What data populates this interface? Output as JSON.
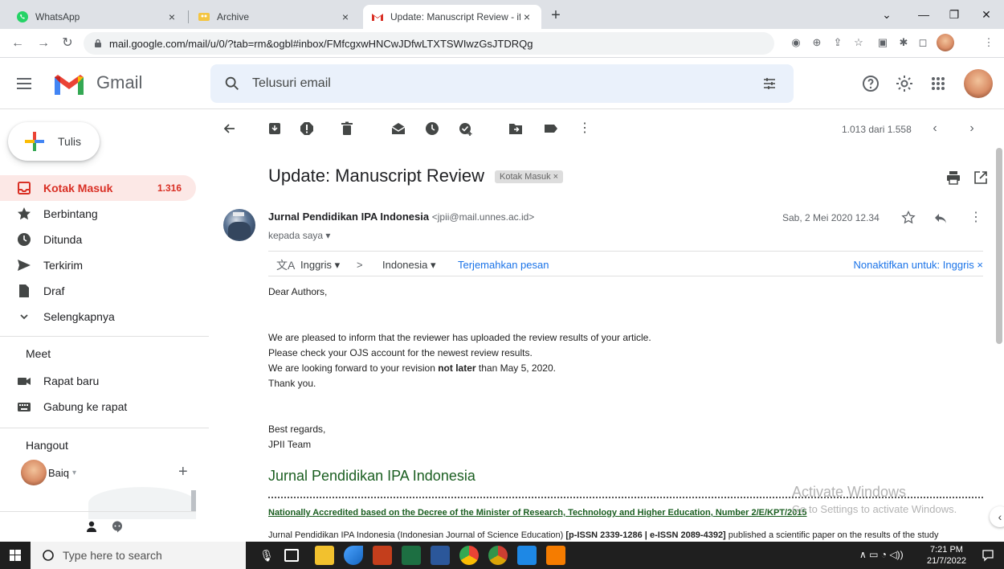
{
  "browser": {
    "tabs": [
      {
        "title": "WhatsApp",
        "close": "×"
      },
      {
        "title": "Archive",
        "close": "×"
      },
      {
        "title": "Update: Manuscript Review - ifat",
        "close": "×"
      }
    ],
    "new_tab": "+",
    "url": "mail.google.com/mail/u/0/?tab=rm&ogbl#inbox/FMfcgxwHNCwJDfwLTXTSWIwzGsJTDRQg"
  },
  "gmail": {
    "wordmark": "Gmail",
    "search_placeholder": "Telusuri email"
  },
  "sidebar": {
    "compose_label": "Tulis",
    "items": [
      {
        "label": "Kotak Masuk",
        "count": "1.316"
      },
      {
        "label": "Berbintang"
      },
      {
        "label": "Ditunda"
      },
      {
        "label": "Terkirim"
      },
      {
        "label": "Draf"
      },
      {
        "label": "Selengkapnya"
      }
    ],
    "meet_title": "Meet",
    "meet_items": [
      {
        "label": "Rapat baru"
      },
      {
        "label": "Gabung ke rapat"
      }
    ],
    "hangout_title": "Hangout",
    "hangout_user": "Baiq",
    "hangout_add": "+"
  },
  "toolbar": {
    "pager": "1.013 dari 1.558"
  },
  "message": {
    "subject": "Update: Manuscript Review",
    "label": "Kotak Masuk ×",
    "sender_name": "Jurnal Pendidikan IPA Indonesia",
    "sender_email": "<jpii@mail.unnes.ac.id>",
    "recipient": "kepada saya ▾",
    "date": "Sab, 2 Mei 2020 12.34",
    "translate": {
      "from": "Inggris ▾",
      "arrow": ">",
      "to": "Indonesia ▾",
      "action": "Terjemahkan pesan",
      "disable": "Nonaktifkan untuk: Inggris ×"
    },
    "body": {
      "greeting": "Dear Authors,",
      "line1": "We are pleased to inform that the reviewer has uploaded the review results of your article.",
      "line2": "Please check your OJS account for the newest review results.",
      "line3_pre": "We are looking forward to your revision ",
      "line3_bold": "not later",
      "line3_post": " than May 5, 2020.",
      "line4": "Thank you.",
      "regards": "Best regards,",
      "team": "JPII Team"
    },
    "journal_title": "Jurnal Pendidikan IPA Indonesia",
    "accreditation": "Nationally Accredited based on the Decree of the Minister of Research, Technology and Higher Education, Number 2/E/KPT/2015",
    "description_pre": "Jurnal Pendidikan IPA Indonesia (Indonesian Journal of Science Education) ",
    "description_bold": "[p-ISSN 2339-1286 | e-ISSN 2089-4392]",
    "description_post": " published a scientific paper on the results of the study"
  },
  "watermark": {
    "title": "Activate Windows",
    "subtitle": "Go to Settings to activate Windows."
  },
  "taskbar": {
    "search_placeholder": "Type here to search",
    "time": "7:21 PM",
    "date": "21/7/2022"
  },
  "colors": {
    "gmail_red": "#d93025",
    "active_bg": "#fce8e6",
    "search_bg": "#eaf1fb",
    "link_blue": "#1a73e8",
    "journal_green": "#1a5e20",
    "taskbar": "#1f1f1f"
  }
}
